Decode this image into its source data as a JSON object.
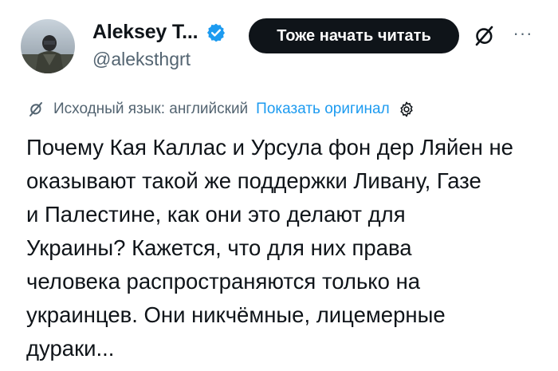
{
  "author": {
    "display_name": "Aleksey T...",
    "handle": "@aleksthgrt",
    "verified": true
  },
  "actions": {
    "follow_label": "Тоже начать читать",
    "grok_icon": "grok-icon",
    "more_label": "···"
  },
  "translation": {
    "source_language": "Исходный язык: английский",
    "show_original": "Показать оригинал"
  },
  "tweet": {
    "text": "Почему Кая Каллас и Урсула фон дер Ляйен не\nоказывают такой же поддержки Ливану, Газе\nи Палестине, как они это делают для\nУкраины? Кажется, что для них права\nчеловека распространяются только на\nукраинцев. Они никчёмные, лицемерные\nдураки..."
  },
  "colors": {
    "text": "#0f1419",
    "secondary": "#536471",
    "link": "#1d9bf0",
    "button_bg": "#0f1419"
  }
}
